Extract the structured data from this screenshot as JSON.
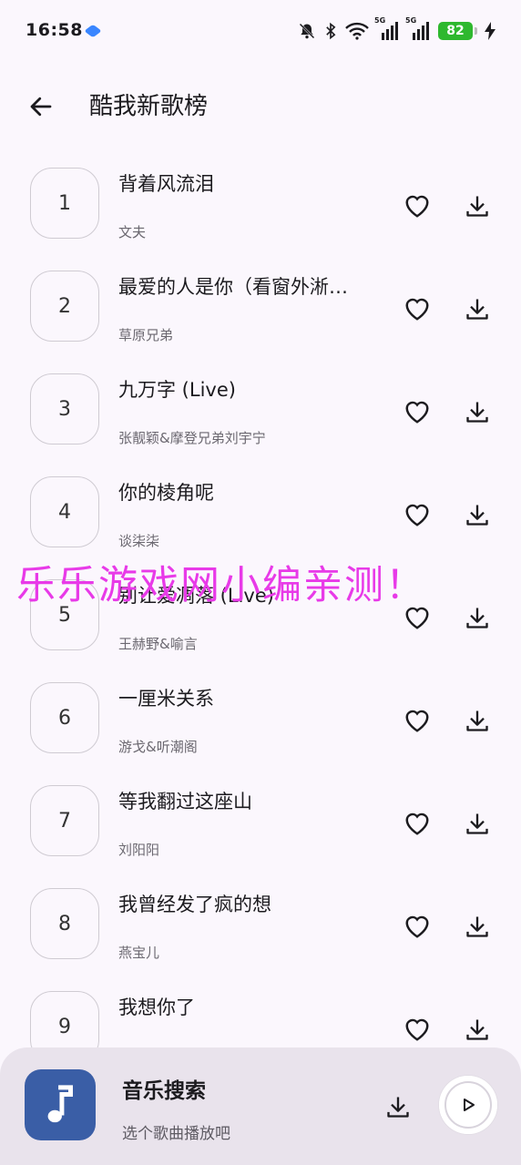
{
  "status_bar": {
    "time": "16:58",
    "battery": "82",
    "signal_label_1": "5G",
    "signal_label_2": "5G"
  },
  "header": {
    "title": "酷我新歌榜",
    "back_icon": "arrow-left-icon"
  },
  "songs": [
    {
      "rank": "1",
      "title": "背着风流泪",
      "artist": "文夫"
    },
    {
      "rank": "2",
      "title": "最爱的人是你（看窗外淅…",
      "artist": "草原兄弟"
    },
    {
      "rank": "3",
      "title": "九万字 (Live)",
      "artist": "张靓颖&摩登兄弟刘宇宁"
    },
    {
      "rank": "4",
      "title": "你的棱角呢",
      "artist": "谈柒柒"
    },
    {
      "rank": "5",
      "title": "别让爱凋落 (Live)",
      "artist": "王赫野&喻言"
    },
    {
      "rank": "6",
      "title": "一厘米关系",
      "artist": "游戈&听潮阁"
    },
    {
      "rank": "7",
      "title": "等我翻过这座山",
      "artist": "刘阳阳"
    },
    {
      "rank": "8",
      "title": "我曾经发了疯的想",
      "artist": "燕宝儿"
    },
    {
      "rank": "9",
      "title": "我想你了",
      "artist": ""
    }
  ],
  "watermark": "乐乐游戏网小编亲测！",
  "player": {
    "title": "音乐搜索",
    "subtitle": "选个歌曲播放吧"
  },
  "colors": {
    "accent": "#3a5ea6",
    "watermark": "#e83ae8",
    "background": "#fbf7fd",
    "player_bg": "#e9e3ec"
  }
}
